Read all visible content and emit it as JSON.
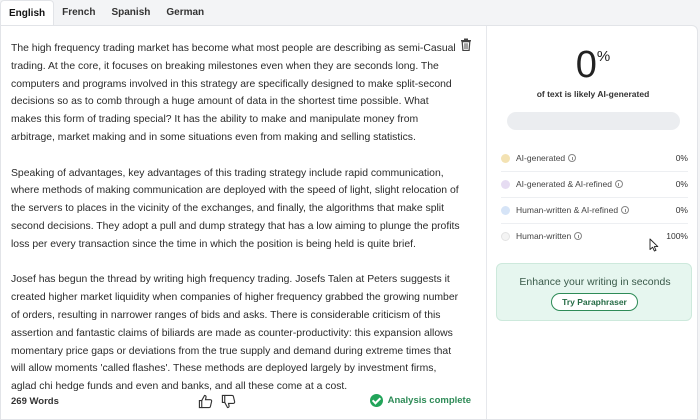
{
  "tabs": [
    {
      "label": "English",
      "active": true
    },
    {
      "label": "French",
      "active": false
    },
    {
      "label": "Spanish",
      "active": false
    },
    {
      "label": "German",
      "active": false
    }
  ],
  "editor": {
    "paragraphs": [
      "The high frequency trading market has become what most people are describing as semi-Casual trading. At the core, it focuses on breaking milestones even when they are seconds long. The computers and programs involved in this strategy are specifically designed to make split-second decisions so as to comb through a huge amount of data in the shortest time possible. What makes this form of trading special? It has the ability to make and manipulate money from arbitrage, market making and in some situations even from making and selling statistics.",
      "Speaking of advantages, key advantages of this trading strategy include rapid communication, where methods of making communication are deployed with the speed of light, slight relocation of the servers to places in the vicinity of the exchanges, and finally, the algorithms that make split second decisions. They adopt a pull and dump strategy that has a low aiming to plunge the profits loss per every transaction since the time in which the position is being held is quite brief.",
      "Josef has begun the thread by writing high frequency trading. Josefs Talen at Peters suggests it created higher market liquidity when companies of higher frequency grabbed the growing number of orders, resulting in narrower ranges of bids and asks. There is considerable criticism of this assertion and fantastic claims of biliards are made as counter-productivity: this expansion allows momentary price gaps or deviations from the true supply and demand during extreme times that will allow moments 'called flashes'. These methods are deployed largely by investment firms, aglad chi hedge funds and even and banks, and all these come at a cost."
    ],
    "word_count": "269 Words",
    "status": "Analysis complete"
  },
  "results": {
    "score_value": "0",
    "score_unit": "%",
    "score_label": "of text is likely AI-generated",
    "score_fraction": 0,
    "rows": [
      {
        "label": "AI-generated",
        "percent": "0%",
        "color": "#f3e2b3"
      },
      {
        "label": "AI-generated & AI-refined",
        "percent": "0%",
        "color": "#e6dcf2"
      },
      {
        "label": "Human-written & AI-refined",
        "percent": "0%",
        "color": "#d6e4f7"
      },
      {
        "label": "Human-written",
        "percent": "100%",
        "color": "#f4f4f4"
      }
    ],
    "promo_text": "Enhance your writing in seconds",
    "promo_button": "Try Paraphraser"
  },
  "colors": {
    "accent_green": "#22a45a",
    "promo_bg": "#e6f6ef"
  },
  "icons": [
    "trash-icon",
    "thumbs-up-icon",
    "thumbs-down-icon",
    "check-circle-icon",
    "info-icon",
    "mouse-cursor-icon"
  ]
}
